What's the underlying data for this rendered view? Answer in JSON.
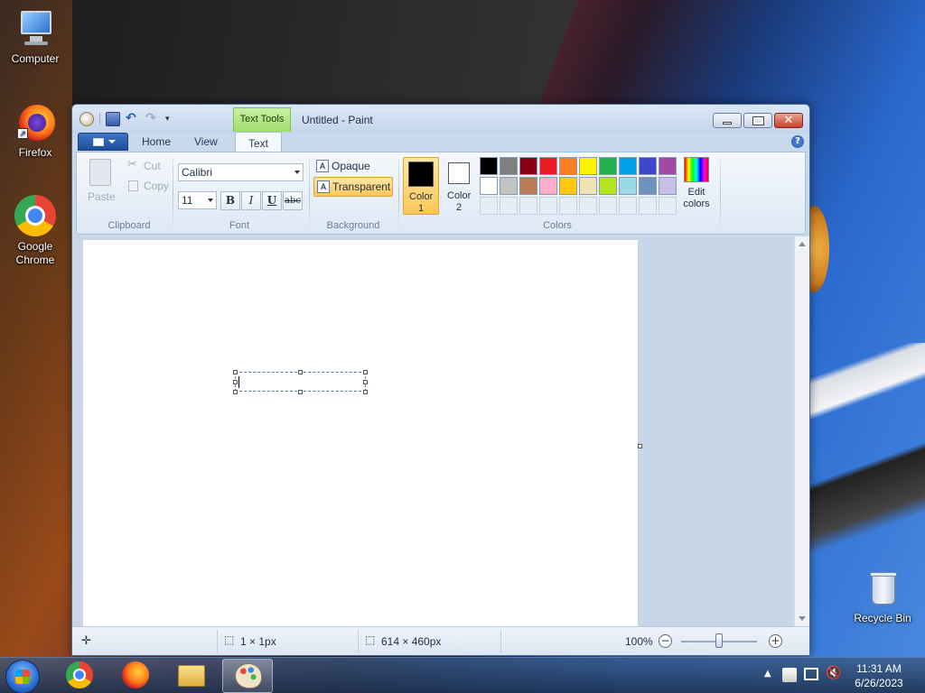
{
  "desktop": {
    "icons": [
      {
        "label": "Computer"
      },
      {
        "label": "Firefox"
      },
      {
        "label": "Google Chrome"
      },
      {
        "label": "Recycle Bin"
      }
    ]
  },
  "window": {
    "title": "Untitled - Paint",
    "contextual_tab": "Text Tools",
    "tabs": [
      {
        "label": "Home"
      },
      {
        "label": "View"
      },
      {
        "label": "Text"
      }
    ],
    "help_glyph": "?"
  },
  "ribbon": {
    "clipboard": {
      "paste": "Paste",
      "cut": "Cut",
      "copy": "Copy",
      "label": "Clipboard"
    },
    "font": {
      "family": "Calibri",
      "size": "11",
      "bold": "B",
      "italic": "I",
      "underline": "U",
      "strike": "abc",
      "label": "Font"
    },
    "background": {
      "opaque": "Opaque",
      "transparent": "Transparent",
      "label": "Background",
      "selected": "transparent"
    },
    "colors": {
      "color1": "Color 1",
      "color2": "Color 2",
      "color1_value": "#000000",
      "color2_value": "#ffffff",
      "edit": "Edit colors",
      "label": "Colors",
      "palette": [
        "#000000",
        "#7f7f7f",
        "#880015",
        "#ed1c24",
        "#ff7f27",
        "#fff200",
        "#22b14c",
        "#00a2e8",
        "#3f48cc",
        "#a349a4",
        "#ffffff",
        "#c3c3c3",
        "#b97a57",
        "#ffaec9",
        "#ffc90e",
        "#efe4b0",
        "#b5e61d",
        "#99d9ea",
        "#7092be",
        "#c8bfe7"
      ],
      "empty_slots": 10
    }
  },
  "status": {
    "selection_size": "1 × 1px",
    "canvas_size": "614 × 460px",
    "zoom": "100%",
    "zoom_out": "−",
    "zoom_in": "+"
  },
  "taskbar": {
    "time": "11:31 AM",
    "date": "6/26/2023"
  }
}
